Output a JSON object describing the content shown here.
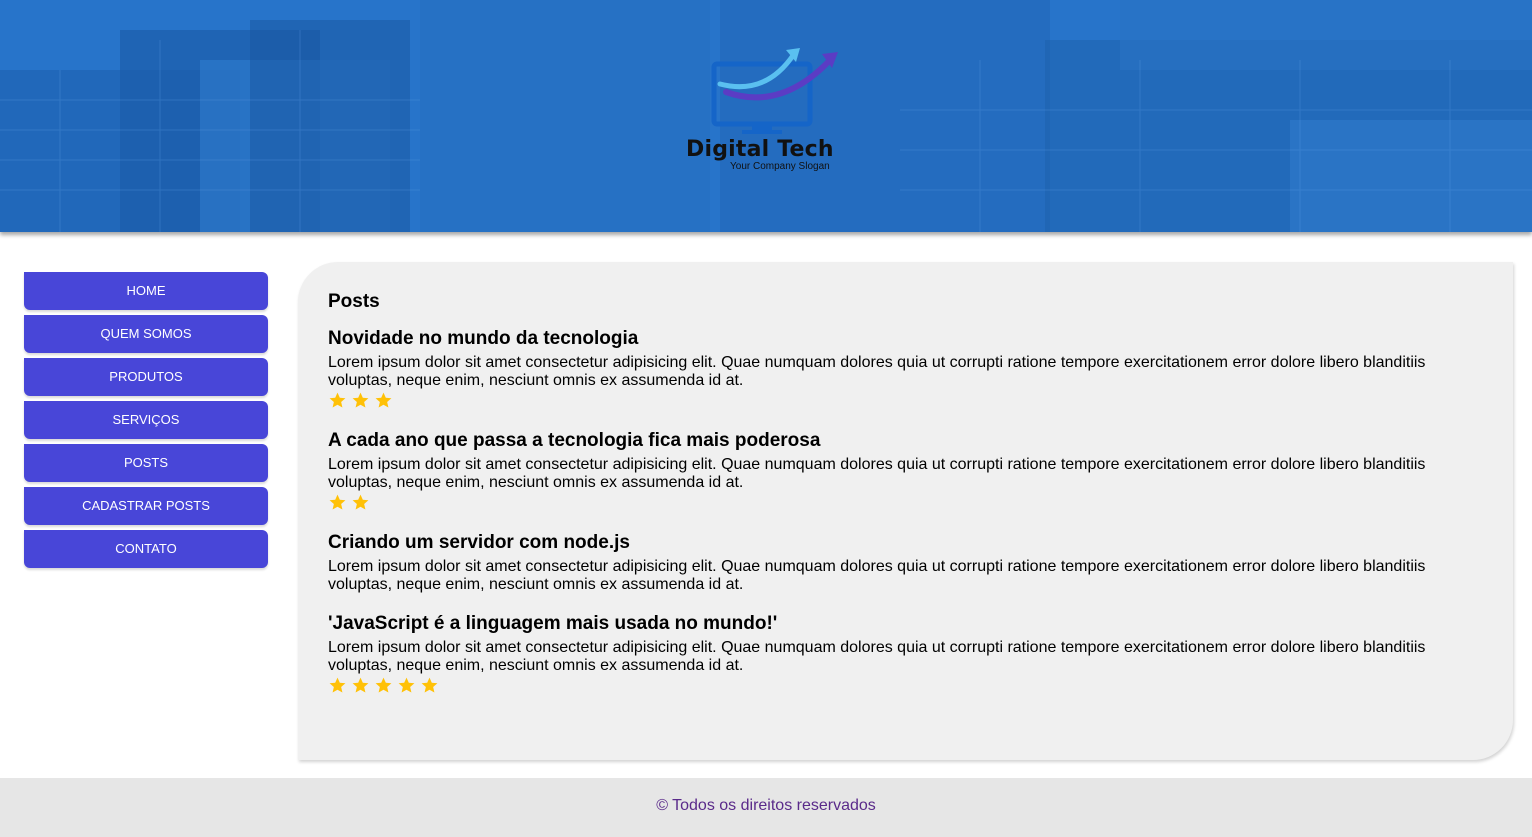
{
  "brand": {
    "title": "Digital Tech",
    "slogan": "Your Company Slogan"
  },
  "nav": {
    "items": [
      {
        "label": "HOME"
      },
      {
        "label": "QUEM SOMOS"
      },
      {
        "label": "PRODUTOS"
      },
      {
        "label": "SERVIÇOS"
      },
      {
        "label": "POSTS"
      },
      {
        "label": "CADASTRAR POSTS"
      },
      {
        "label": "CONTATO"
      }
    ]
  },
  "main": {
    "title": "Posts",
    "posts": [
      {
        "title": "Novidade no mundo da tecnologia",
        "body": "Lorem ipsum dolor sit amet consectetur adipisicing elit. Quae numquam dolores quia ut corrupti ratione tempore exercitationem error dolore libero blanditiis voluptas, neque enim, nesciunt omnis ex assumenda id at.",
        "rating": 3
      },
      {
        "title": "A cada ano que passa a tecnologia fica mais poderosa",
        "body": "Lorem ipsum dolor sit amet consectetur adipisicing elit. Quae numquam dolores quia ut corrupti ratione tempore exercitationem error dolore libero blanditiis voluptas, neque enim, nesciunt omnis ex assumenda id at.",
        "rating": 2
      },
      {
        "title": "Criando um servidor com node.js",
        "body": "Lorem ipsum dolor sit amet consectetur adipisicing elit. Quae numquam dolores quia ut corrupti ratione tempore exercitationem error dolore libero blanditiis voluptas, neque enim, nesciunt omnis ex assumenda id at.",
        "rating": 0
      },
      {
        "title": "'JavaScript é a linguagem mais usada no mundo!'",
        "body": "Lorem ipsum dolor sit amet consectetur adipisicing elit. Quae numquam dolores quia ut corrupti ratione tempore exercitationem error dolore libero blanditiis voluptas, neque enim, nesciunt omnis ex assumenda id at.",
        "rating": 5
      }
    ]
  },
  "footer": {
    "text": "© Todos os direitos reservados"
  },
  "colors": {
    "nav_bg": "#4846d8",
    "star": "#ffc107",
    "banner": "#1f6cc0",
    "footer_text": "#5a2a8a"
  },
  "icons": {
    "logo": "monitor-with-arrow-logo",
    "rating": "star-icon"
  }
}
